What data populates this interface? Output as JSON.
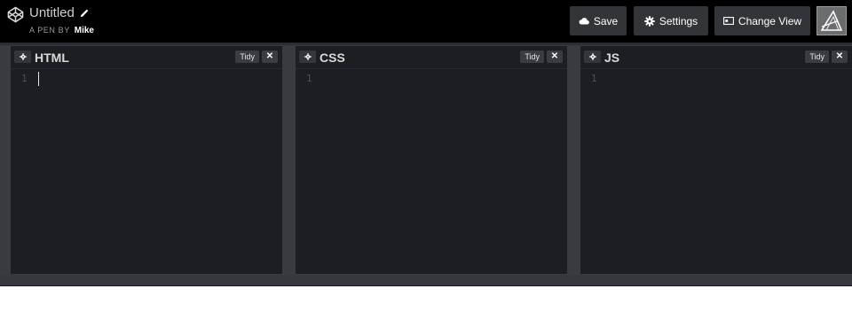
{
  "header": {
    "pen_title": "Untitled",
    "byline_prefix": "A PEN BY",
    "author": "Mike",
    "buttons": {
      "save": "Save",
      "settings": "Settings",
      "change_view": "Change View"
    }
  },
  "panes": [
    {
      "label": "HTML",
      "tidy": "Tidy",
      "line_number": "1"
    },
    {
      "label": "CSS",
      "tidy": "Tidy",
      "line_number": "1"
    },
    {
      "label": "JS",
      "tidy": "Tidy",
      "line_number": "1"
    }
  ],
  "icons": {
    "logo": "codepen-logo-icon",
    "edit": "pencil-icon",
    "save": "cloud-icon",
    "settings": "gear-icon",
    "change_view": "layout-icon",
    "close": "close-icon"
  },
  "colors": {
    "header_bg": "#000000",
    "button_bg": "#333438",
    "pane_bg": "#1d1e22",
    "gutter_bg": "#3a3b3f"
  }
}
